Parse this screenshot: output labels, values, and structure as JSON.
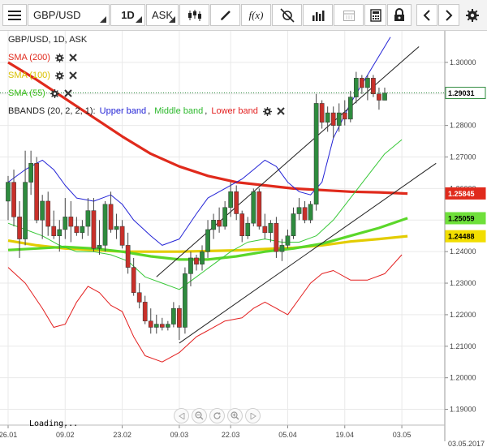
{
  "toolbar": {
    "symbol": "GBP/USD",
    "timeframe": "1D",
    "price_side": "ASK",
    "fx_label": "f(x)"
  },
  "legend": {
    "title": "GBP/USD, 1D, ASK",
    "sma200": "SMA (200)",
    "sma100": "SMA (100)",
    "sma55": "SMA (55)",
    "bbands_prefix": "BBANDS (20, 2, 2, 1): ",
    "bb_upper": "Upper band",
    "bb_middle": "Middle band",
    "bb_lower": "Lower band"
  },
  "colors": {
    "bull": "#2e8b3e",
    "bear": "#c8302a",
    "sma200": "#e02a1c",
    "sma100": "#e3cc00",
    "sma55": "#5bd72a",
    "bb_upper": "#2323d6",
    "bb_middle": "#38c838",
    "bb_lower": "#e31e1e"
  },
  "status": {
    "loading": "Loading..."
  },
  "chart_data": {
    "type": "candlestick",
    "title": "GBP/USD, 1D, ASK",
    "ylim": [
      1.185,
      1.31
    ],
    "y_ticks": [
      "1.30000",
      "1.29000",
      "1.28000",
      "1.27000",
      "1.26000",
      "1.25000",
      "1.24000",
      "1.23000",
      "1.22000",
      "1.21000",
      "1.20000",
      "1.19000"
    ],
    "x_labels": [
      {
        "label": "26.01",
        "index": 0
      },
      {
        "label": "09.02",
        "index": 10
      },
      {
        "label": "23.02",
        "index": 20
      },
      {
        "label": "09.03",
        "index": 30
      },
      {
        "label": "22.03",
        "index": 39
      },
      {
        "label": "05.04",
        "index": 49
      },
      {
        "label": "19.04",
        "index": 59
      },
      {
        "label": "03.05",
        "index": 69
      }
    ],
    "axis_end_label": "03.05.2017",
    "price_labels": [
      {
        "series": "last",
        "value": 1.29031,
        "text": "1.29031"
      },
      {
        "series": "sma200",
        "value": 1.25845,
        "text": "1.25845"
      },
      {
        "series": "sma55",
        "value": 1.25059,
        "text": "1.25059"
      },
      {
        "series": "sma100",
        "value": 1.24488,
        "text": "1.24488"
      }
    ],
    "candles": [
      [
        1.256,
        1.264,
        1.25,
        1.262
      ],
      [
        1.262,
        1.266,
        1.248,
        1.251
      ],
      [
        1.251,
        1.256,
        1.238,
        1.244
      ],
      [
        1.244,
        1.272,
        1.242,
        1.262
      ],
      [
        1.262,
        1.272,
        1.258,
        1.268
      ],
      [
        1.268,
        1.27,
        1.249,
        1.25
      ],
      [
        1.25,
        1.258,
        1.244,
        1.256
      ],
      [
        1.256,
        1.259,
        1.245,
        1.248
      ],
      [
        1.248,
        1.253,
        1.244,
        1.245
      ],
      [
        1.245,
        1.25,
        1.24,
        1.247
      ],
      [
        1.247,
        1.257,
        1.244,
        1.251
      ],
      [
        1.251,
        1.256,
        1.243,
        1.248
      ],
      [
        1.248,
        1.251,
        1.245,
        1.246
      ],
      [
        1.246,
        1.25,
        1.244,
        1.248
      ],
      [
        1.248,
        1.257,
        1.245,
        1.253
      ],
      [
        1.253,
        1.257,
        1.24,
        1.241
      ],
      [
        1.241,
        1.25,
        1.239,
        1.242
      ],
      [
        1.242,
        1.256,
        1.24,
        1.255
      ],
      [
        1.255,
        1.259,
        1.246,
        1.247
      ],
      [
        1.247,
        1.252,
        1.244,
        1.248
      ],
      [
        1.248,
        1.25,
        1.241,
        1.242
      ],
      [
        1.242,
        1.246,
        1.233,
        1.235
      ],
      [
        1.235,
        1.238,
        1.226,
        1.227
      ],
      [
        1.227,
        1.23,
        1.222,
        1.224
      ],
      [
        1.224,
        1.226,
        1.217,
        1.218
      ],
      [
        1.218,
        1.222,
        1.214,
        1.216
      ],
      [
        1.216,
        1.22,
        1.214,
        1.217
      ],
      [
        1.217,
        1.219,
        1.215,
        1.216
      ],
      [
        1.216,
        1.218,
        1.215,
        1.217
      ],
      [
        1.217,
        1.224,
        1.216,
        1.222
      ],
      [
        1.222,
        1.223,
        1.212,
        1.216
      ],
      [
        1.216,
        1.235,
        1.214,
        1.233
      ],
      [
        1.233,
        1.24,
        1.229,
        1.238
      ],
      [
        1.238,
        1.239,
        1.234,
        1.236
      ],
      [
        1.236,
        1.242,
        1.234,
        1.24
      ],
      [
        1.24,
        1.25,
        1.238,
        1.247
      ],
      [
        1.247,
        1.252,
        1.244,
        1.25
      ],
      [
        1.25,
        1.254,
        1.246,
        1.248
      ],
      [
        1.248,
        1.256,
        1.247,
        1.254
      ],
      [
        1.254,
        1.262,
        1.251,
        1.259
      ],
      [
        1.259,
        1.261,
        1.25,
        1.252
      ],
      [
        1.252,
        1.253,
        1.243,
        1.245
      ],
      [
        1.245,
        1.251,
        1.244,
        1.249
      ],
      [
        1.249,
        1.26,
        1.248,
        1.259
      ],
      [
        1.259,
        1.26,
        1.247,
        1.248
      ],
      [
        1.248,
        1.252,
        1.244,
        1.246
      ],
      [
        1.246,
        1.25,
        1.243,
        1.249
      ],
      [
        1.249,
        1.251,
        1.238,
        1.24
      ],
      [
        1.24,
        1.244,
        1.237,
        1.242
      ],
      [
        1.242,
        1.247,
        1.241,
        1.245
      ],
      [
        1.245,
        1.254,
        1.244,
        1.252
      ],
      [
        1.252,
        1.257,
        1.25,
        1.254
      ],
      [
        1.254,
        1.256,
        1.249,
        1.25
      ],
      [
        1.25,
        1.256,
        1.249,
        1.255
      ],
      [
        1.255,
        1.29,
        1.253,
        1.287
      ],
      [
        1.287,
        1.288,
        1.279,
        1.281
      ],
      [
        1.281,
        1.286,
        1.278,
        1.284
      ],
      [
        1.284,
        1.286,
        1.276,
        1.28
      ],
      [
        1.28,
        1.287,
        1.278,
        1.284
      ],
      [
        1.284,
        1.288,
        1.28,
        1.282
      ],
      [
        1.282,
        1.291,
        1.281,
        1.289
      ],
      [
        1.289,
        1.297,
        1.287,
        1.295
      ],
      [
        1.295,
        1.296,
        1.29,
        1.292
      ],
      [
        1.292,
        1.296,
        1.288,
        1.295
      ],
      [
        1.295,
        1.296,
        1.289,
        1.29
      ],
      [
        1.29,
        1.292,
        1.285,
        1.288
      ],
      [
        1.288,
        1.292,
        1.288,
        1.2903
      ]
    ],
    "series": [
      {
        "name": "SMA (200)",
        "points": [
          [
            0,
            1.3
          ],
          [
            5,
            1.2945
          ],
          [
            10,
            1.2885
          ],
          [
            15,
            1.2825
          ],
          [
            20,
            1.2765
          ],
          [
            25,
            1.271
          ],
          [
            30,
            1.267
          ],
          [
            35,
            1.264
          ],
          [
            40,
            1.262
          ],
          [
            45,
            1.261
          ],
          [
            50,
            1.26
          ],
          [
            55,
            1.2595
          ],
          [
            60,
            1.259
          ],
          [
            65,
            1.2588
          ],
          [
            70,
            1.2584
          ]
        ]
      },
      {
        "name": "SMA (100)",
        "points": [
          [
            0,
            1.2435
          ],
          [
            5,
            1.242
          ],
          [
            10,
            1.241
          ],
          [
            15,
            1.2405
          ],
          [
            20,
            1.24
          ],
          [
            25,
            1.24
          ],
          [
            30,
            1.24
          ],
          [
            35,
            1.2402
          ],
          [
            40,
            1.2404
          ],
          [
            45,
            1.2408
          ],
          [
            50,
            1.2412
          ],
          [
            55,
            1.242
          ],
          [
            60,
            1.2432
          ],
          [
            65,
            1.244
          ],
          [
            70,
            1.2449
          ]
        ]
      },
      {
        "name": "SMA (55)",
        "points": [
          [
            0,
            1.2405
          ],
          [
            5,
            1.241
          ],
          [
            10,
            1.2415
          ],
          [
            15,
            1.241
          ],
          [
            20,
            1.24
          ],
          [
            25,
            1.2385
          ],
          [
            30,
            1.2375
          ],
          [
            35,
            1.2375
          ],
          [
            40,
            1.2385
          ],
          [
            45,
            1.24
          ],
          [
            50,
            1.241
          ],
          [
            55,
            1.2425
          ],
          [
            60,
            1.245
          ],
          [
            65,
            1.2475
          ],
          [
            70,
            1.2506
          ]
        ]
      },
      {
        "name": "Upper band",
        "points": [
          [
            0,
            1.262
          ],
          [
            3,
            1.266
          ],
          [
            6,
            1.269
          ],
          [
            8,
            1.266
          ],
          [
            10,
            1.261
          ],
          [
            12,
            1.257
          ],
          [
            15,
            1.256
          ],
          [
            18,
            1.258
          ],
          [
            20,
            1.255
          ],
          [
            22,
            1.25
          ],
          [
            25,
            1.245
          ],
          [
            27,
            1.242
          ],
          [
            30,
            1.244
          ],
          [
            33,
            1.252
          ],
          [
            35,
            1.257
          ],
          [
            38,
            1.26
          ],
          [
            41,
            1.263
          ],
          [
            43,
            1.266
          ],
          [
            45,
            1.269
          ],
          [
            47,
            1.267
          ],
          [
            49,
            1.262
          ],
          [
            51,
            1.259
          ],
          [
            53,
            1.258
          ],
          [
            55,
            1.262
          ],
          [
            57,
            1.276
          ],
          [
            60,
            1.287
          ],
          [
            63,
            1.296
          ],
          [
            66,
            1.305
          ],
          [
            67,
            1.308
          ]
        ]
      },
      {
        "name": "Middle band",
        "points": [
          [
            0,
            1.249
          ],
          [
            3,
            1.247
          ],
          [
            6,
            1.245
          ],
          [
            9,
            1.242
          ],
          [
            12,
            1.24
          ],
          [
            15,
            1.24
          ],
          [
            18,
            1.239
          ],
          [
            21,
            1.237
          ],
          [
            24,
            1.232
          ],
          [
            27,
            1.23
          ],
          [
            30,
            1.228
          ],
          [
            33,
            1.232
          ],
          [
            36,
            1.236
          ],
          [
            39,
            1.24
          ],
          [
            42,
            1.243
          ],
          [
            45,
            1.244
          ],
          [
            48,
            1.243
          ],
          [
            51,
            1.243
          ],
          [
            54,
            1.245
          ],
          [
            57,
            1.25
          ],
          [
            60,
            1.257
          ],
          [
            63,
            1.264
          ],
          [
            66,
            1.271
          ],
          [
            69,
            1.2755
          ]
        ]
      },
      {
        "name": "Lower band",
        "points": [
          [
            0,
            1.235
          ],
          [
            3,
            1.23
          ],
          [
            6,
            1.222
          ],
          [
            8,
            1.216
          ],
          [
            10,
            1.217
          ],
          [
            12,
            1.224
          ],
          [
            14,
            1.229
          ],
          [
            16,
            1.227
          ],
          [
            18,
            1.223
          ],
          [
            20,
            1.221
          ],
          [
            22,
            1.213
          ],
          [
            24,
            1.207
          ],
          [
            27,
            1.205
          ],
          [
            30,
            1.208
          ],
          [
            33,
            1.213
          ],
          [
            35,
            1.215
          ],
          [
            38,
            1.218
          ],
          [
            41,
            1.219
          ],
          [
            43,
            1.222
          ],
          [
            45,
            1.224
          ],
          [
            47,
            1.222
          ],
          [
            49,
            1.22
          ],
          [
            51,
            1.225
          ],
          [
            53,
            1.23
          ],
          [
            55,
            1.233
          ],
          [
            57,
            1.234
          ],
          [
            60,
            1.231
          ],
          [
            63,
            1.231
          ],
          [
            66,
            1.233
          ],
          [
            69,
            1.239
          ]
        ]
      }
    ],
    "trendlines": [
      {
        "from": [
          26,
          1.232
        ],
        "to": [
          72,
          1.305
        ]
      },
      {
        "from": [
          30,
          1.211
        ],
        "to": [
          75,
          1.268
        ]
      }
    ]
  }
}
